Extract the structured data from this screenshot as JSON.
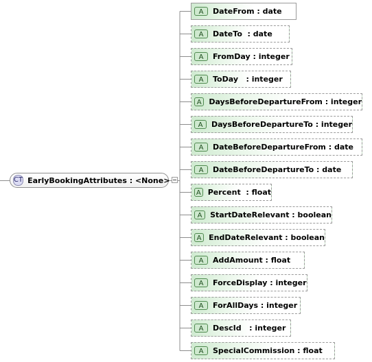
{
  "complex_type": {
    "badge": "CT",
    "label": "EarlyBookingAttributes : <None>"
  },
  "attribute_badge": "A",
  "attributes": [
    {
      "label": "DateFrom : date",
      "required": true
    },
    {
      "label": "DateTo  : date",
      "required": false
    },
    {
      "label": "FromDay : integer",
      "required": false
    },
    {
      "label": "ToDay   : integer",
      "required": false
    },
    {
      "label": "DaysBeforeDepartureFrom : integer",
      "required": false
    },
    {
      "label": "DaysBeforeDepartureTo : integer",
      "required": false
    },
    {
      "label": "DateBeforeDepartureFrom : date",
      "required": false
    },
    {
      "label": "DateBeforeDepartureTo : date",
      "required": false
    },
    {
      "label": "Percent  : float",
      "required": false
    },
    {
      "label": "StartDateRelevant : boolean",
      "required": false
    },
    {
      "label": "EndDateRelevant : boolean",
      "required": false
    },
    {
      "label": "AddAmount : float",
      "required": false
    },
    {
      "label": "ForceDisplay : integer",
      "required": false
    },
    {
      "label": "ForAllDays : integer",
      "required": false
    },
    {
      "label": "DescId   : integer",
      "required": false
    },
    {
      "label": "SpecialCommission : float",
      "required": false
    }
  ]
}
